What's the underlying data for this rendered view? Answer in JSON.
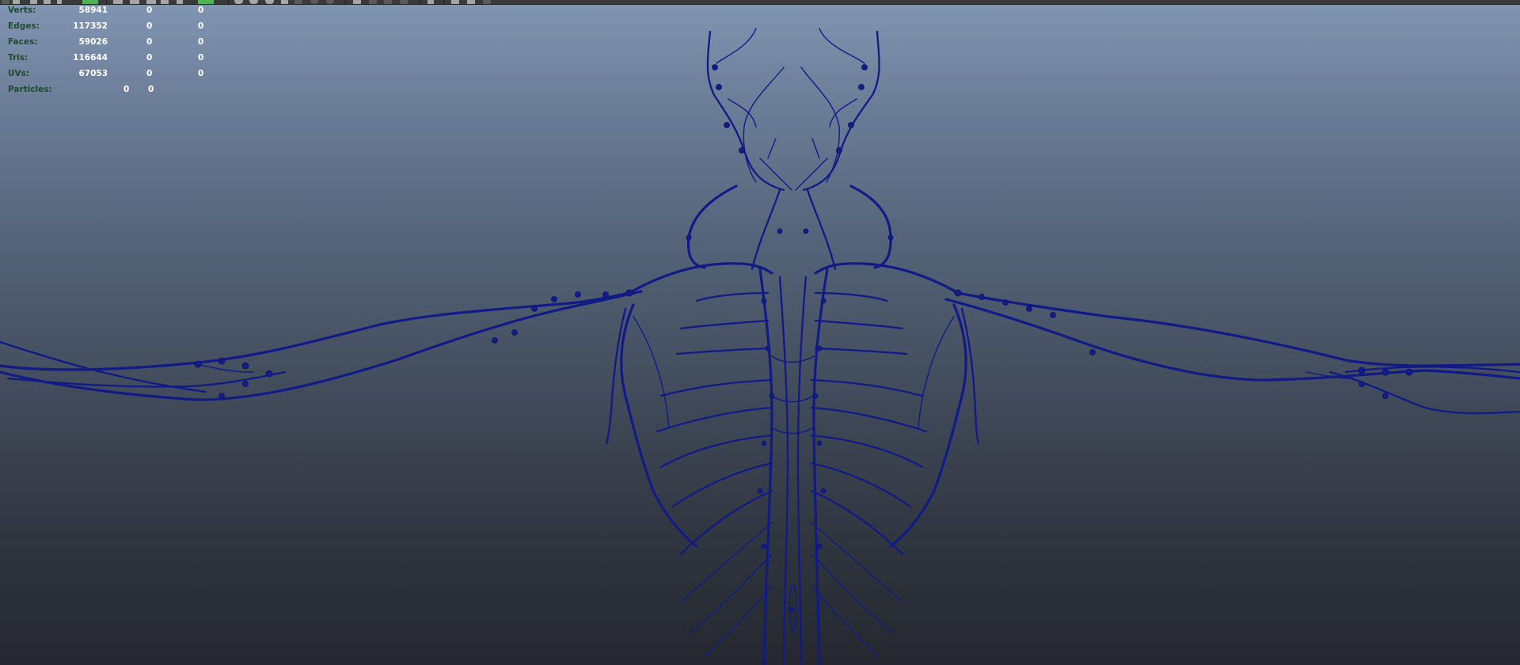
{
  "viewport_stats": {
    "rows": [
      {
        "label": "Verts:",
        "values": [
          "58941",
          "0",
          "0"
        ]
      },
      {
        "label": "Edges:",
        "values": [
          "117352",
          "0",
          "0"
        ]
      },
      {
        "label": "Faces:",
        "values": [
          "59026",
          "0",
          "0"
        ]
      },
      {
        "label": "Tris:",
        "values": [
          "116644",
          "0",
          "0"
        ]
      },
      {
        "label": "UVs:",
        "values": [
          "67053",
          "0",
          "0"
        ]
      }
    ],
    "particles": {
      "label": "Particles:",
      "values": [
        "0",
        "0"
      ]
    }
  },
  "colors": {
    "stat_label": "#1f4a2d",
    "stat_value": "#ffffff",
    "vessel": "#111a86",
    "background_top": "#8196b4",
    "background_bottom": "#25282e"
  },
  "toolbar": {
    "icons": [
      "select-icon",
      "move-icon",
      "layout-icon",
      "snap-icon",
      "render-icon",
      "light-icon",
      "camera-icon",
      "shading-icon",
      "isolate-icon"
    ]
  },
  "scene": {
    "object": "lymphatic-system-model"
  }
}
